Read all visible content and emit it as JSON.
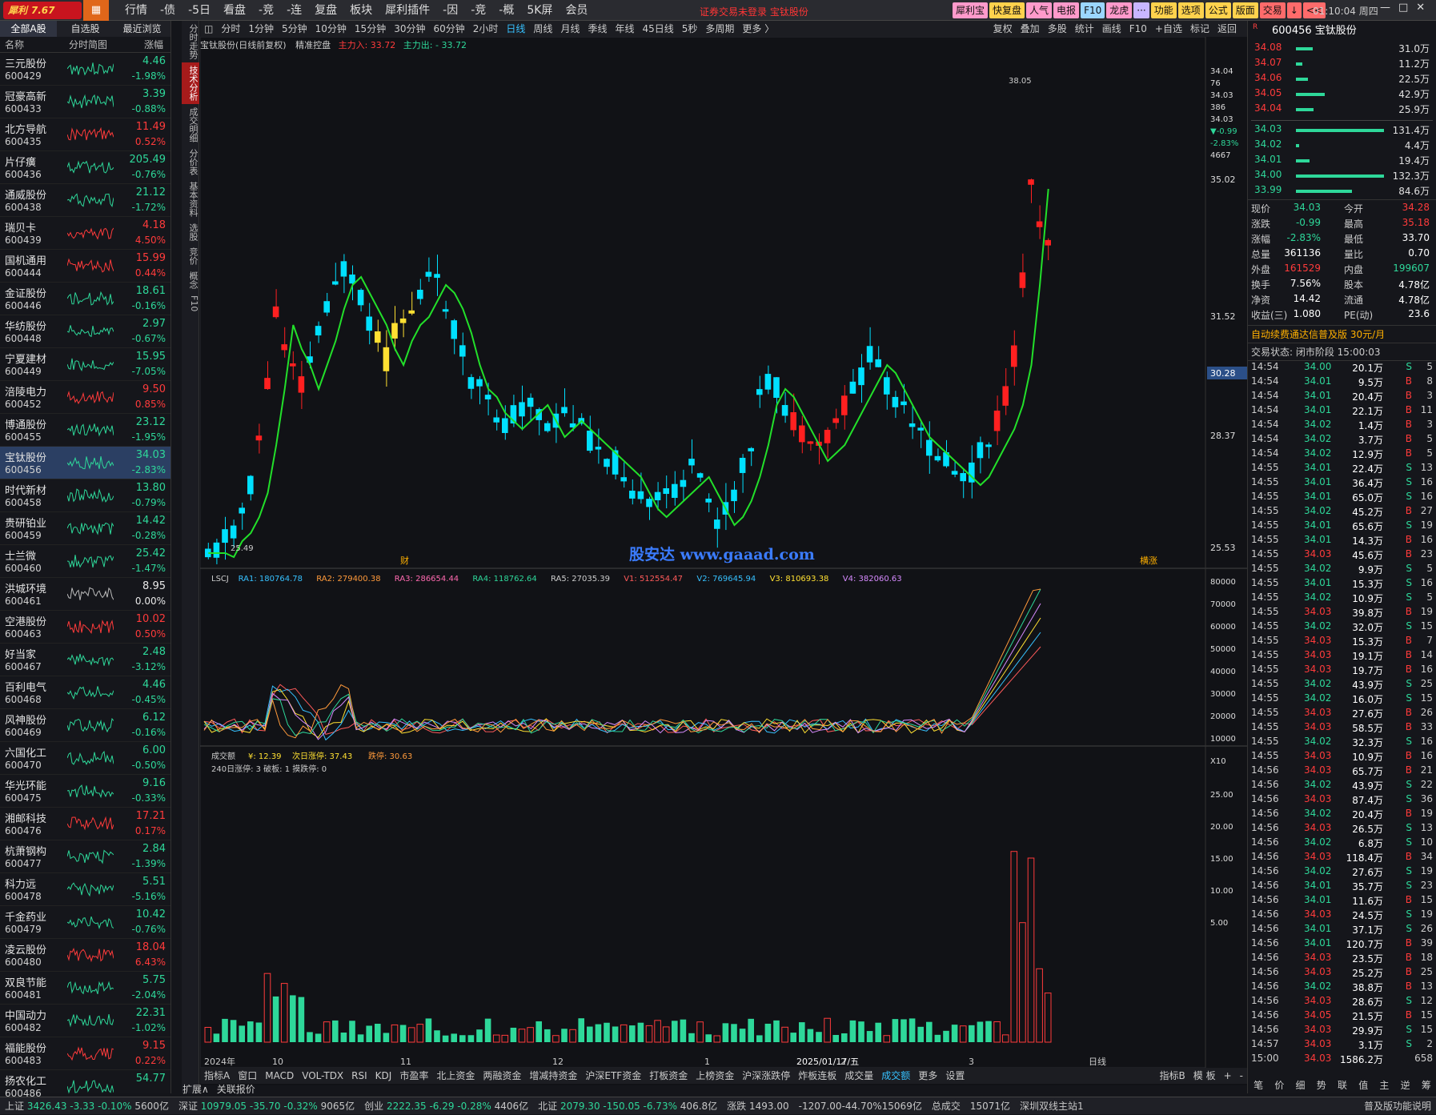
{
  "app": {
    "name": "犀利",
    "version": "7.67"
  },
  "menu": [
    "行情",
    "-债",
    "-5日",
    "看盘",
    "-竞",
    "-连",
    "复盘",
    "板块",
    "犀利插件",
    "-因",
    "-竞",
    "-概",
    "5K屏",
    "会员"
  ],
  "notice": "证券交易未登录  宝钛股份",
  "toolbar": [
    "犀利宝",
    "快复盘",
    "人气",
    "电报",
    "F10",
    "龙虎",
    "···",
    "功能",
    "选项",
    "公式",
    "版面",
    "交易",
    "↓",
    "<<"
  ],
  "clock": "01:10:04 周四",
  "left": {
    "tabs": [
      "全部A股",
      "自选股",
      "最近浏览"
    ],
    "header": [
      "名称",
      "分时简图",
      "涨幅"
    ],
    "stocks": [
      {
        "name": "三元股份",
        "code": "600429",
        "price": "4.46",
        "chg": "-1.98%",
        "dir": "dn"
      },
      {
        "name": "冠豪高新",
        "code": "600433",
        "price": "3.39",
        "chg": "-0.88%",
        "dir": "dn"
      },
      {
        "name": "北方导航",
        "code": "600435",
        "price": "11.49",
        "chg": "0.52%",
        "dir": "up"
      },
      {
        "name": "片仔癀",
        "code": "600436",
        "price": "205.49",
        "chg": "-0.76%",
        "dir": "dn"
      },
      {
        "name": "通威股份",
        "code": "600438",
        "price": "21.12",
        "chg": "-1.72%",
        "dir": "dn"
      },
      {
        "name": "瑞贝卡",
        "code": "600439",
        "price": "4.18",
        "chg": "4.50%",
        "dir": "up"
      },
      {
        "name": "国机通用",
        "code": "600444",
        "price": "15.99",
        "chg": "0.44%",
        "dir": "up"
      },
      {
        "name": "金证股份",
        "code": "600446",
        "price": "18.61",
        "chg": "-0.16%",
        "dir": "dn"
      },
      {
        "name": "华纺股份",
        "code": "600448",
        "price": "2.97",
        "chg": "-0.67%",
        "dir": "dn"
      },
      {
        "name": "宁夏建材",
        "code": "600449",
        "price": "15.95",
        "chg": "-7.05%",
        "dir": "dn"
      },
      {
        "name": "涪陵电力",
        "code": "600452",
        "price": "9.50",
        "chg": "0.85%",
        "dir": "up"
      },
      {
        "name": "博通股份",
        "code": "600455",
        "price": "23.12",
        "chg": "-1.95%",
        "dir": "dn"
      },
      {
        "name": "宝钛股份",
        "code": "600456",
        "price": "34.03",
        "chg": "-2.83%",
        "dir": "dn",
        "sel": true
      },
      {
        "name": "时代新材",
        "code": "600458",
        "price": "13.80",
        "chg": "-0.79%",
        "dir": "dn"
      },
      {
        "name": "贵研铂业",
        "code": "600459",
        "price": "14.42",
        "chg": "-0.28%",
        "dir": "dn"
      },
      {
        "name": "士兰微",
        "code": "600460",
        "price": "25.42",
        "chg": "-1.47%",
        "dir": "dn"
      },
      {
        "name": "洪城环境",
        "code": "600461",
        "price": "8.95",
        "chg": "0.00%",
        "dir": "fl"
      },
      {
        "name": "空港股份",
        "code": "600463",
        "price": "10.02",
        "chg": "0.50%",
        "dir": "up"
      },
      {
        "name": "好当家",
        "code": "600467",
        "price": "2.48",
        "chg": "-3.12%",
        "dir": "dn"
      },
      {
        "name": "百利电气",
        "code": "600468",
        "price": "4.46",
        "chg": "-0.45%",
        "dir": "dn"
      },
      {
        "name": "风神股份",
        "code": "600469",
        "price": "6.12",
        "chg": "-0.16%",
        "dir": "dn"
      },
      {
        "name": "六国化工",
        "code": "600470",
        "price": "6.00",
        "chg": "-0.50%",
        "dir": "dn"
      },
      {
        "name": "华光环能",
        "code": "600475",
        "price": "9.16",
        "chg": "-0.33%",
        "dir": "dn"
      },
      {
        "name": "湘邮科技",
        "code": "600476",
        "price": "17.21",
        "chg": "0.17%",
        "dir": "up"
      },
      {
        "name": "杭萧钢构",
        "code": "600477",
        "price": "2.84",
        "chg": "-1.39%",
        "dir": "dn"
      },
      {
        "name": "科力远",
        "code": "600478",
        "price": "5.51",
        "chg": "-5.16%",
        "dir": "dn"
      },
      {
        "name": "千金药业",
        "code": "600479",
        "price": "10.42",
        "chg": "-0.76%",
        "dir": "dn"
      },
      {
        "name": "凌云股份",
        "code": "600480",
        "price": "18.04",
        "chg": "6.43%",
        "dir": "up"
      },
      {
        "name": "双良节能",
        "code": "600481",
        "price": "5.75",
        "chg": "-2.04%",
        "dir": "dn"
      },
      {
        "name": "中国动力",
        "code": "600482",
        "price": "22.31",
        "chg": "-1.02%",
        "dir": "dn"
      },
      {
        "name": "福能股份",
        "code": "600483",
        "price": "9.15",
        "chg": "0.22%",
        "dir": "up"
      },
      {
        "name": "扬农化工",
        "code": "600486",
        "price": "54.77",
        "chg": "",
        "dir": "dn"
      }
    ]
  },
  "vtabs": [
    "分时走势",
    "技术分析",
    "成交明细",
    "分价表",
    "基本资料",
    "选股",
    "竞价",
    "概念",
    "F10"
  ],
  "chart": {
    "periods": [
      "分时",
      "1分钟",
      "5分钟",
      "10分钟",
      "15分钟",
      "30分钟",
      "60分钟",
      "2小时",
      "日线",
      "周线",
      "月线",
      "季线",
      "年线",
      "45日线",
      "5秒",
      "多周期",
      "更多 〉"
    ],
    "active_period": "日线",
    "tools": [
      "复权",
      "叠加",
      "多股",
      "统计",
      "画线",
      "F10",
      "+自选",
      "标记",
      "返回"
    ],
    "info": "宝钛股份(日线前复权)",
    "indicator": "精准控盘",
    "main_in": "主力入: 33.72",
    "main_out": "主力出: - 33.72",
    "watermark": "股安达 www.gaaad.com",
    "price_axis": [
      "35.02",
      "31.52",
      "28.37",
      "25.53"
    ],
    "top_ticks": [
      "34.04",
      "76",
      "34.03",
      "386",
      "34.03",
      "▼-0.99",
      "-2.83%",
      "4667"
    ],
    "hi_label": "38.05",
    "lo_label": "25.49",
    "cross_price": "30.28",
    "sig_cai": "财",
    "sig_zt": "横涨",
    "lscj": {
      "name": "LSCJ",
      "ra1": "RA1: 180764.78",
      "ra2": "RA2: 279400.38",
      "ra3": "RA3: 286654.44",
      "ra4": "RA4: 118762.64",
      "ra5": "RA5: 27035.39",
      "v1": "V1: 512554.47",
      "v2": "V2: 769645.94",
      "v3": "V3: 810693.38",
      "v4": "V4: 382060.63"
    },
    "lscj_axis": [
      "80000",
      "70000",
      "60000",
      "50000",
      "40000",
      "30000",
      "20000",
      "10000",
      "X10"
    ],
    "vol_info": {
      "name": "成交额",
      "y": "¥: 12.39",
      "next": "次日涨停: 37.43",
      "drop": "跌停: 30.63",
      "stat": "240日涨停: 3  破板: 1  摸跌停: 0"
    },
    "vol_axis": [
      "25.00",
      "20.00",
      "15.00",
      "10.00",
      "5.00"
    ],
    "date_axis": [
      "2024年",
      "10",
      "11",
      "12",
      "1",
      "2025/01/17/五",
      "2",
      "3",
      "日线"
    ],
    "bottom_tabs": [
      "指标A",
      "窗口",
      "MACD",
      "VOL-TDX",
      "RSI",
      "KDJ",
      "市盈率",
      "北上资金",
      "两融资金",
      "增减持资金",
      "沪深ETF资金",
      "打板资金",
      "上榜资金",
      "沪深涨跌停",
      "炸板连板",
      "成交量",
      "成交额",
      "更多",
      "设置"
    ],
    "active_bottom": "成交额",
    "bottom_right": [
      "指标B",
      "模 板",
      "+",
      "-"
    ],
    "ext": [
      "扩展∧",
      "关联报价"
    ]
  },
  "right": {
    "title": "600456 宝钛股份",
    "r_badge": "R",
    "sell": [
      {
        "p": "34.08",
        "v": "31.0万",
        "w": 0.19
      },
      {
        "p": "34.07",
        "v": "11.2万",
        "w": 0.07
      },
      {
        "p": "34.06",
        "v": "22.5万",
        "w": 0.14
      },
      {
        "p": "34.05",
        "v": "42.9万",
        "w": 0.33
      },
      {
        "p": "34.04",
        "v": "25.9万",
        "w": 0.2
      }
    ],
    "buy": [
      {
        "p": "34.03",
        "v": "131.4万",
        "w": 1.0
      },
      {
        "p": "34.02",
        "v": "4.4万",
        "w": 0.04
      },
      {
        "p": "34.01",
        "v": "19.4万",
        "w": 0.15
      },
      {
        "p": "34.00",
        "v": "132.3万",
        "w": 1.0
      },
      {
        "p": "33.99",
        "v": "84.6万",
        "w": 0.64
      }
    ],
    "stats": [
      [
        "现价",
        "34.03",
        "今开",
        "34.28"
      ],
      [
        "涨跌",
        "-0.99",
        "最高",
        "35.18"
      ],
      [
        "涨幅",
        "-2.83%",
        "最低",
        "33.70"
      ],
      [
        "总量",
        "361136",
        "量比",
        "0.70"
      ],
      [
        "外盘",
        "161529",
        "内盘",
        "199607"
      ],
      [
        "换手",
        "7.56%",
        "股本",
        "4.78亿"
      ],
      [
        "净资",
        "14.42",
        "流通",
        "4.78亿"
      ],
      [
        "收益(三)",
        "1.080",
        "PE(动)",
        "23.6"
      ]
    ],
    "promo": "自动续费通达信普及版  30元/月",
    "state": "交易状态: 闭市阶段 15:00:03",
    "ticks": [
      [
        "14:54",
        "34.00",
        "20.1万",
        "S",
        "5"
      ],
      [
        "14:54",
        "34.01",
        "9.5万",
        "B",
        "8"
      ],
      [
        "14:54",
        "34.01",
        "20.4万",
        "B",
        "3"
      ],
      [
        "14:54",
        "34.01",
        "22.1万",
        "B",
        "11"
      ],
      [
        "14:54",
        "34.02",
        "1.4万",
        "B",
        "3"
      ],
      [
        "14:54",
        "34.02",
        "3.7万",
        "B",
        "5"
      ],
      [
        "14:54",
        "34.02",
        "12.9万",
        "B",
        "5"
      ],
      [
        "14:55",
        "34.01",
        "22.4万",
        "S",
        "13"
      ],
      [
        "14:55",
        "34.01",
        "36.4万",
        "S",
        "16"
      ],
      [
        "14:55",
        "34.01",
        "65.0万",
        "S",
        "16"
      ],
      [
        "14:55",
        "34.02",
        "45.2万",
        "B",
        "27"
      ],
      [
        "14:55",
        "34.01",
        "65.6万",
        "S",
        "19"
      ],
      [
        "14:55",
        "34.01",
        "14.3万",
        "B",
        "16"
      ],
      [
        "14:55",
        "34.03",
        "45.6万",
        "B",
        "23"
      ],
      [
        "14:55",
        "34.02",
        "9.9万",
        "S",
        "5"
      ],
      [
        "14:55",
        "34.01",
        "15.3万",
        "S",
        "16"
      ],
      [
        "14:55",
        "34.02",
        "10.9万",
        "S",
        "5"
      ],
      [
        "14:55",
        "34.03",
        "39.8万",
        "B",
        "19"
      ],
      [
        "14:55",
        "34.02",
        "32.0万",
        "S",
        "15"
      ],
      [
        "14:55",
        "34.03",
        "15.3万",
        "B",
        "7"
      ],
      [
        "14:55",
        "34.03",
        "19.1万",
        "B",
        "14"
      ],
      [
        "14:55",
        "34.03",
        "19.7万",
        "B",
        "16"
      ],
      [
        "14:55",
        "34.02",
        "43.9万",
        "S",
        "25"
      ],
      [
        "14:55",
        "34.02",
        "16.0万",
        "S",
        "15"
      ],
      [
        "14:55",
        "34.03",
        "27.6万",
        "B",
        "26"
      ],
      [
        "14:55",
        "34.03",
        "58.5万",
        "B",
        "33"
      ],
      [
        "14:55",
        "34.02",
        "32.3万",
        "S",
        "16"
      ],
      [
        "14:55",
        "34.03",
        "10.9万",
        "B",
        "16"
      ],
      [
        "14:56",
        "34.03",
        "65.7万",
        "B",
        "21"
      ],
      [
        "14:56",
        "34.02",
        "43.9万",
        "S",
        "22"
      ],
      [
        "14:56",
        "34.03",
        "87.4万",
        "S",
        "36"
      ],
      [
        "14:56",
        "34.02",
        "20.4万",
        "B",
        "19"
      ],
      [
        "14:56",
        "34.03",
        "26.5万",
        "S",
        "13"
      ],
      [
        "14:56",
        "34.02",
        "6.8万",
        "S",
        "10"
      ],
      [
        "14:56",
        "34.03",
        "118.4万",
        "B",
        "34"
      ],
      [
        "14:56",
        "34.02",
        "27.6万",
        "S",
        "19"
      ],
      [
        "14:56",
        "34.01",
        "35.7万",
        "S",
        "23"
      ],
      [
        "14:56",
        "34.01",
        "11.6万",
        "B",
        "15"
      ],
      [
        "14:56",
        "34.03",
        "24.5万",
        "S",
        "19"
      ],
      [
        "14:56",
        "34.01",
        "37.1万",
        "S",
        "26"
      ],
      [
        "14:56",
        "34.01",
        "120.7万",
        "B",
        "39"
      ],
      [
        "14:56",
        "34.03",
        "23.5万",
        "B",
        "18"
      ],
      [
        "14:56",
        "34.03",
        "25.2万",
        "B",
        "25"
      ],
      [
        "14:56",
        "34.02",
        "38.8万",
        "B",
        "13"
      ],
      [
        "14:56",
        "34.03",
        "28.6万",
        "S",
        "12"
      ],
      [
        "14:56",
        "34.05",
        "21.5万",
        "B",
        "15"
      ],
      [
        "14:56",
        "34.03",
        "29.9万",
        "S",
        "15"
      ],
      [
        "14:57",
        "34.03",
        "3.1万",
        "S",
        "2"
      ],
      [
        "15:00",
        "34.03",
        "1586.2万",
        "",
        "658"
      ]
    ],
    "bottom_tabs": [
      "笔",
      "价",
      "细",
      "势",
      "联",
      "值",
      "主",
      "逆",
      "筹"
    ]
  },
  "statusbar": [
    {
      "t": "上证",
      "v": "3426.43",
      "c": "-3.33",
      "p": "-0.10%",
      "a": "5600亿"
    },
    {
      "t": "深证",
      "v": "10979.05",
      "c": "-35.70",
      "p": "-0.32%",
      "a": "9065亿"
    },
    {
      "t": "创业",
      "v": "2222.35",
      "c": "-6.29",
      "p": "-0.28%",
      "a": "4406亿"
    },
    {
      "t": "北证",
      "v": "2079.30",
      "c": "-150.05",
      "p": "-6.73%",
      "a": "406.8亿"
    }
  ],
  "status_extra": [
    "涨跌 1493.00",
    "-1207.00-44.70%15069亿",
    "总成交",
    "15071亿",
    "深圳双线主站1"
  ],
  "status_right": "普及版功能说明",
  "colors": {
    "up": "#ff3b3b",
    "down": "#2ed89a",
    "accent": "#36c1ff",
    "ma_up": "#ff2020",
    "ma_dn": "#22e02a",
    "yellow": "#ffe032",
    "cyan": "#00e0ff"
  }
}
